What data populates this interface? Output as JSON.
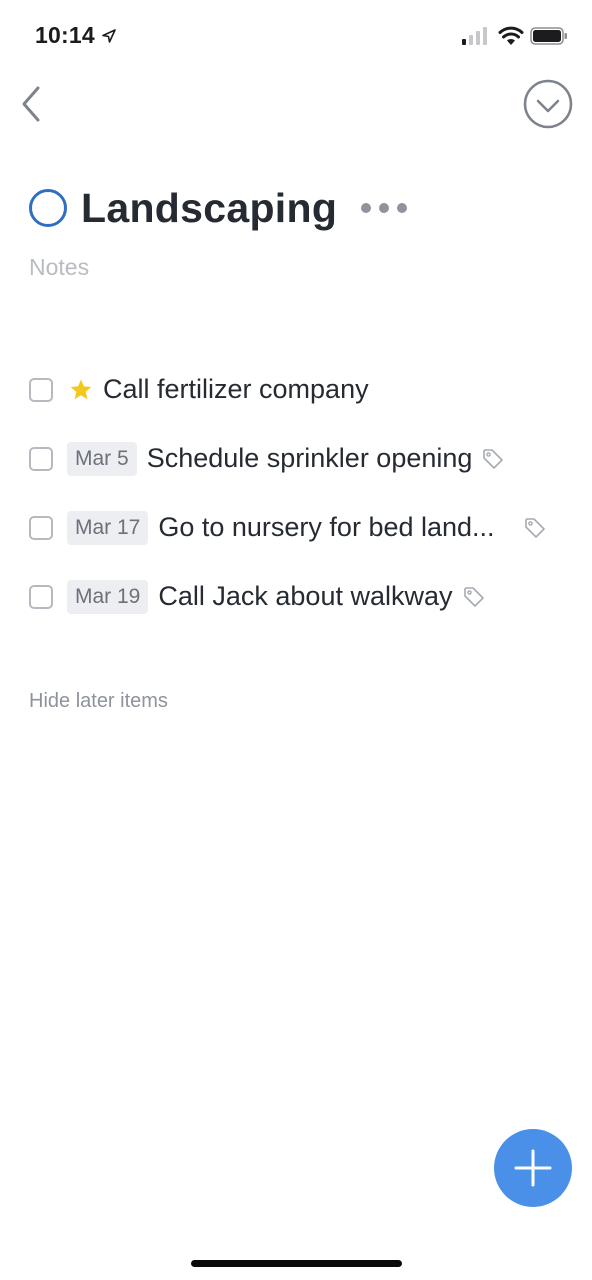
{
  "status_bar": {
    "time": "10:14",
    "location_icon": "location-arrow-icon",
    "signal_icon": "cellular-signal-icon",
    "wifi_icon": "wifi-icon",
    "battery_icon": "battery-icon"
  },
  "nav": {
    "back_icon": "chevron-left-icon",
    "complete_icon": "checkmark-circle-icon"
  },
  "project": {
    "title": "Landscaping",
    "notes_placeholder": "Notes",
    "accent_color": "#2f6ec2"
  },
  "tasks": [
    {
      "title": "Call fertilizer company",
      "starred": true,
      "date": "",
      "has_tag": false
    },
    {
      "title": "Schedule sprinkler opening",
      "starred": false,
      "date": "Mar 5",
      "has_tag": true
    },
    {
      "title": "Go to nursery for bed land...",
      "starred": false,
      "date": "Mar 17",
      "has_tag": true
    },
    {
      "title": "Call Jack about walkway",
      "starred": false,
      "date": "Mar 19",
      "has_tag": true
    }
  ],
  "hide_later_label": "Hide later items",
  "add_button": {
    "icon": "plus-icon",
    "color": "#4a90e8"
  },
  "colors": {
    "star": "#f4c81b",
    "text": "#262b33",
    "muted": "#8e939c"
  }
}
